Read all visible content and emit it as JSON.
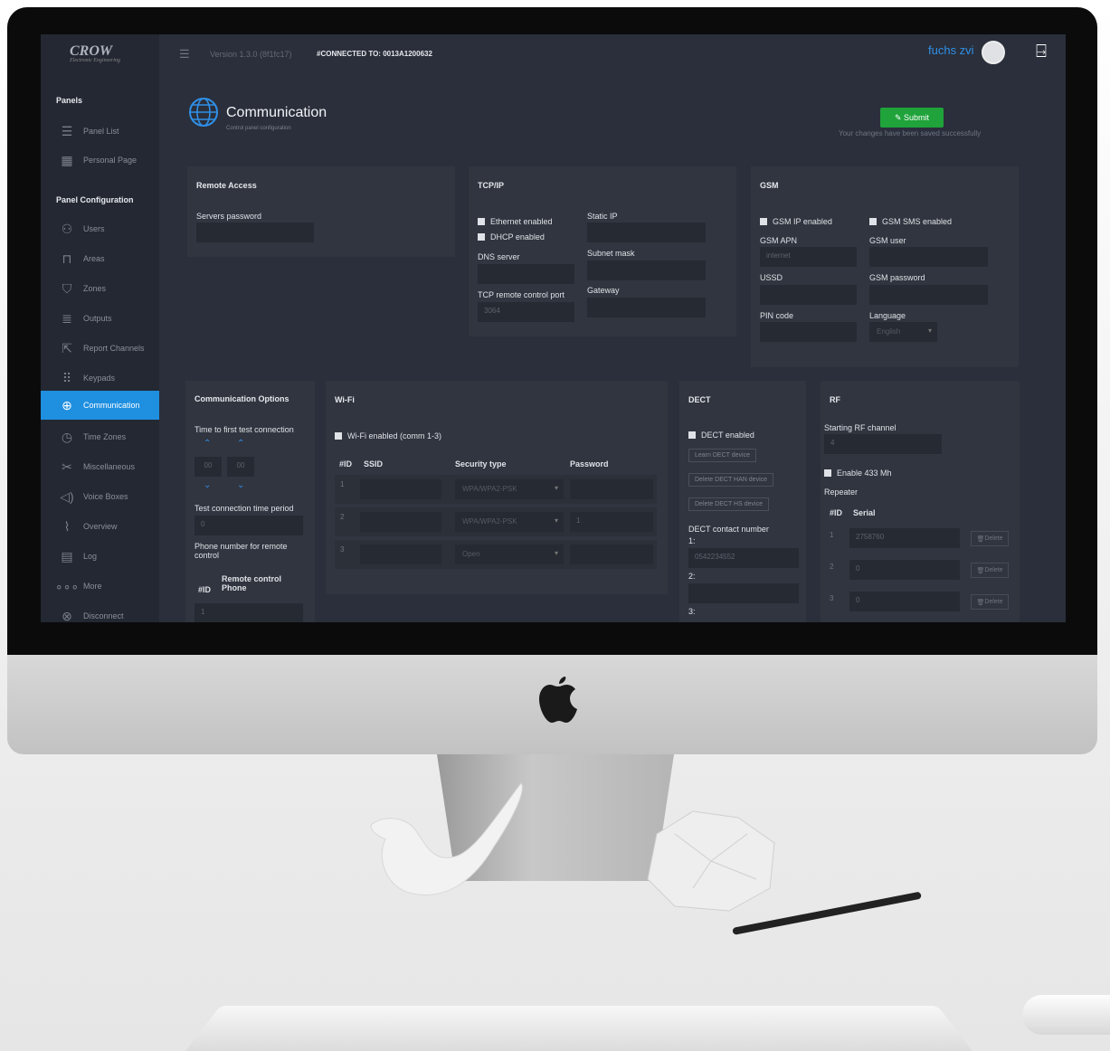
{
  "app": {
    "brand": "CROW",
    "brand_sub": "Electronic Engineering",
    "version": "Version 1.3.0 (8f1fc17)",
    "connected": "#CONNECTED TO: 0013A1200632",
    "user": "fuchs zvi"
  },
  "sidebar": {
    "panels_heading": "Panels",
    "panels_items": [
      {
        "label": "Panel List",
        "icon": "list-icon"
      },
      {
        "label": "Personal Page",
        "icon": "calendar-icon"
      }
    ],
    "config_heading": "Panel Configuration",
    "items": [
      {
        "label": "Users",
        "icon": "users-icon"
      },
      {
        "label": "Areas",
        "icon": "lock-icon"
      },
      {
        "label": "Zones",
        "icon": "zone-icon"
      },
      {
        "label": "Outputs",
        "icon": "outputs-icon"
      },
      {
        "label": "Report Channels",
        "icon": "report-icon"
      },
      {
        "label": "Keypads",
        "icon": "keypad-icon"
      },
      {
        "label": "Communication",
        "icon": "globe-icon"
      },
      {
        "label": "Time Zones",
        "icon": "clock-icon"
      },
      {
        "label": "Miscellaneous",
        "icon": "tools-icon"
      },
      {
        "label": "Voice Boxes",
        "icon": "speaker-icon"
      },
      {
        "label": "Overview",
        "icon": "chart-icon"
      },
      {
        "label": "Log",
        "icon": "log-icon"
      },
      {
        "label": "More",
        "icon": "more-icon"
      },
      {
        "label": "Disconnect",
        "icon": "disconnect-icon"
      }
    ]
  },
  "page": {
    "title": "Communication",
    "subtitle": "Control panel configuration",
    "submit": "Submit",
    "saved_msg": "Your changes have been saved successfully"
  },
  "remote_access": {
    "title": "Remote Access",
    "servers_password": "Servers password"
  },
  "tcpip": {
    "title": "TCP/IP",
    "ethernet": "Ethernet enabled",
    "dhcp": "DHCP enabled",
    "dns": "DNS server",
    "tcp_port": "TCP remote control port",
    "tcp_port_value": "3064",
    "static_ip": "Static IP",
    "subnet": "Subnet mask",
    "gateway": "Gateway"
  },
  "gsm": {
    "title": "GSM",
    "ip_enabled": "GSM IP enabled",
    "sms_enabled": "GSM SMS enabled",
    "apn": "GSM APN",
    "apn_value": "internet",
    "user": "GSM user",
    "ussd": "USSD",
    "password": "GSM password",
    "pin": "PIN code",
    "language": "Language",
    "language_value": "English"
  },
  "comm_options": {
    "title": "Communication Options",
    "first_test": "Time to first test connection",
    "hh": "00",
    "mm": "00",
    "period": "Test connection time period",
    "period_value": "0",
    "phone_label": "Phone number for remote control",
    "col_id": "#ID",
    "col_phone": "Remote control Phone",
    "row1": "1"
  },
  "wifi": {
    "title": "Wi-Fi",
    "enabled": "Wi-Fi enabled (comm 1-3)",
    "col_id": "#ID",
    "col_ssid": "SSID",
    "col_security": "Security type",
    "col_password": "Password",
    "rows": [
      {
        "id": "1",
        "security": "WPA/WPA2-PSK",
        "password": ""
      },
      {
        "id": "2",
        "security": "WPA/WPA2-PSK",
        "password": "1"
      },
      {
        "id": "3",
        "security": "Open",
        "password": ""
      }
    ]
  },
  "dect": {
    "title": "DECT",
    "enabled": "DECT enabled",
    "learn": "Learn DECT device",
    "delete_han": "Delete DECT HAN device",
    "delete_hs": "Delete DECT HS device",
    "contact": "DECT contact number",
    "n1": "1:",
    "v1": "0542234552",
    "n2": "2:",
    "n3": "3:"
  },
  "rf": {
    "title": "RF",
    "start_channel": "Starting RF channel",
    "start_value": "4",
    "enable433": "Enable 433 Mh",
    "repeater": "Repeater",
    "col_id": "#ID",
    "col_serial": "Serial",
    "delete": "Delete",
    "rows": [
      {
        "id": "1",
        "serial": "2758760"
      },
      {
        "id": "2",
        "serial": "0"
      },
      {
        "id": "3",
        "serial": "0"
      }
    ]
  }
}
